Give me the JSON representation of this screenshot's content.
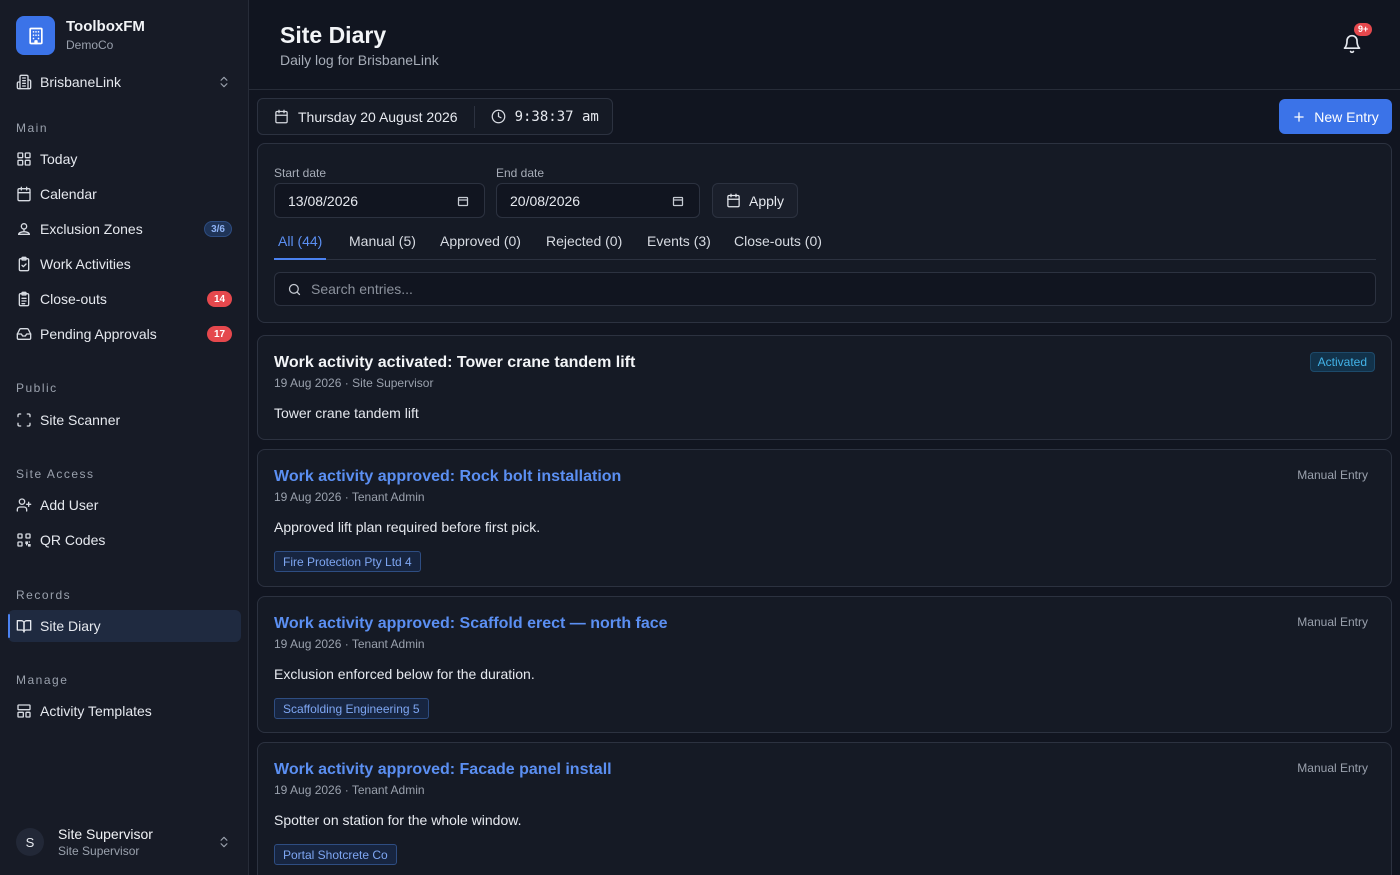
{
  "app": {
    "name": "ToolboxFM",
    "org": "DemoCo"
  },
  "site_selector": {
    "value": "BrisbaneLink"
  },
  "sidebar": {
    "sections": {
      "main": "Main",
      "public": "Public",
      "site_access": "Site Access",
      "records": "Records",
      "manage": "Manage"
    },
    "items": [
      {
        "label": "Today",
        "icon": "grid-icon"
      },
      {
        "label": "Calendar",
        "icon": "calendar-icon"
      },
      {
        "label": "Exclusion Zones",
        "icon": "zone-icon",
        "badge": "3/6"
      },
      {
        "label": "Work Activities",
        "icon": "clipboard-check-icon"
      },
      {
        "label": "Close-outs",
        "icon": "clipboard-list-icon",
        "badge": "14"
      },
      {
        "label": "Pending Approvals",
        "icon": "inbox-icon",
        "badge": "17"
      },
      {
        "label": "Site Scanner",
        "icon": "scan-icon"
      },
      {
        "label": "Add User",
        "icon": "user-plus-icon"
      },
      {
        "label": "QR Codes",
        "icon": "qr-icon"
      },
      {
        "label": "Site Diary",
        "icon": "book-icon"
      },
      {
        "label": "Activity Templates",
        "icon": "template-icon"
      }
    ]
  },
  "user": {
    "initial": "S",
    "name": "Site Supervisor",
    "role": "Site Supervisor"
  },
  "header": {
    "title": "Site Diary",
    "subtitle": "Daily log for BrisbaneLink",
    "notification_count": "9+"
  },
  "datetime": {
    "date": "Thursday 20 August 2026",
    "time": "9:38:37 am"
  },
  "new_entry_label": "New Entry",
  "filters": {
    "start_label": "Start date",
    "start_value": "13/08/2026",
    "end_label": "End date",
    "end_value": "20/08/2026",
    "apply_label": "Apply",
    "tabs": [
      "All (44)",
      "Manual (5)",
      "Approved (0)",
      "Rejected (0)",
      "Events (3)",
      "Close-outs (0)"
    ],
    "search_placeholder": "Search entries..."
  },
  "entries": [
    {
      "title": "Work activity activated: Tower crane tandem lift",
      "meta": "19 Aug 2026 · Site Supervisor",
      "body": "Tower crane tandem lift",
      "tag": "Activated"
    },
    {
      "title": "Work activity approved: Rock bolt installation",
      "meta": "19 Aug 2026 · Tenant Admin",
      "body": "Approved lift plan required before first pick.",
      "tag": "Manual Entry",
      "chip": "Fire Protection Pty Ltd 4"
    },
    {
      "title": "Work activity approved: Scaffold erect — north face",
      "meta": "19 Aug 2026 · Tenant Admin",
      "body": "Exclusion enforced below for the duration.",
      "tag": "Manual Entry",
      "chip": "Scaffolding Engineering 5"
    },
    {
      "title": "Work activity approved: Facade panel install",
      "meta": "19 Aug 2026 · Tenant Admin",
      "body": "Spotter on station for the whole window.",
      "tag": "Manual Entry",
      "chip": "Portal Shotcrete Co"
    }
  ],
  "colors": {
    "accent": "#3b73e8",
    "link": "#5b8ff2",
    "danger": "#e5484d",
    "background": "#111520"
  }
}
